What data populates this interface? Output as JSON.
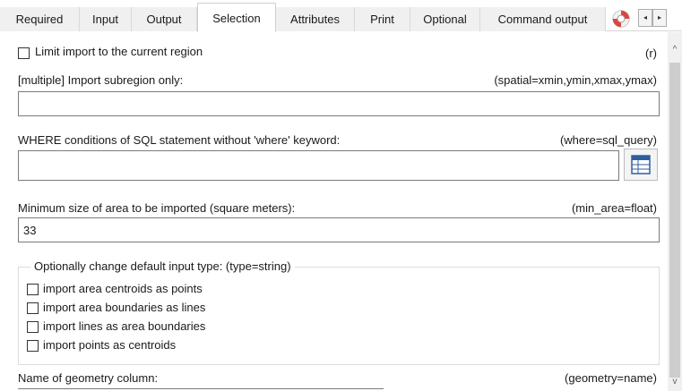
{
  "tabs": [
    {
      "label": "Required",
      "active": false
    },
    {
      "label": "Input",
      "active": false
    },
    {
      "label": "Output",
      "active": false
    },
    {
      "label": "Selection",
      "active": true
    },
    {
      "label": "Attributes",
      "active": false
    },
    {
      "label": "Print",
      "active": false
    },
    {
      "label": "Optional",
      "active": false
    },
    {
      "label": "Command output",
      "active": false
    }
  ],
  "tab_icons": {
    "help": "lifebuoy-icon",
    "prev": "◂",
    "next": "▸"
  },
  "form": {
    "region": {
      "label": "Limit import to the current region",
      "param": "(r)",
      "checked": false
    },
    "spatial": {
      "label": "[multiple] Import subregion only:",
      "param": "(spatial=xmin,ymin,xmax,ymax)",
      "value": ""
    },
    "where": {
      "label": "WHERE conditions of SQL statement without 'where' keyword:",
      "param": "(where=sql_query)",
      "value": ""
    },
    "min_area": {
      "label": "Minimum size of area to be imported (square meters):",
      "param": "(min_area=float)",
      "value": "33"
    },
    "type_group": {
      "legend": "Optionally change default input type:  (type=string)",
      "options": [
        {
          "label": "import area centroids as points",
          "checked": false
        },
        {
          "label": "import area boundaries as lines",
          "checked": false
        },
        {
          "label": "import lines as area boundaries",
          "checked": false
        },
        {
          "label": "import points as centroids",
          "checked": false
        }
      ]
    },
    "geometry": {
      "label": "Name of geometry column:",
      "param": "(geometry=name)"
    }
  },
  "scrollbar": {
    "up": "^",
    "down": "v"
  }
}
